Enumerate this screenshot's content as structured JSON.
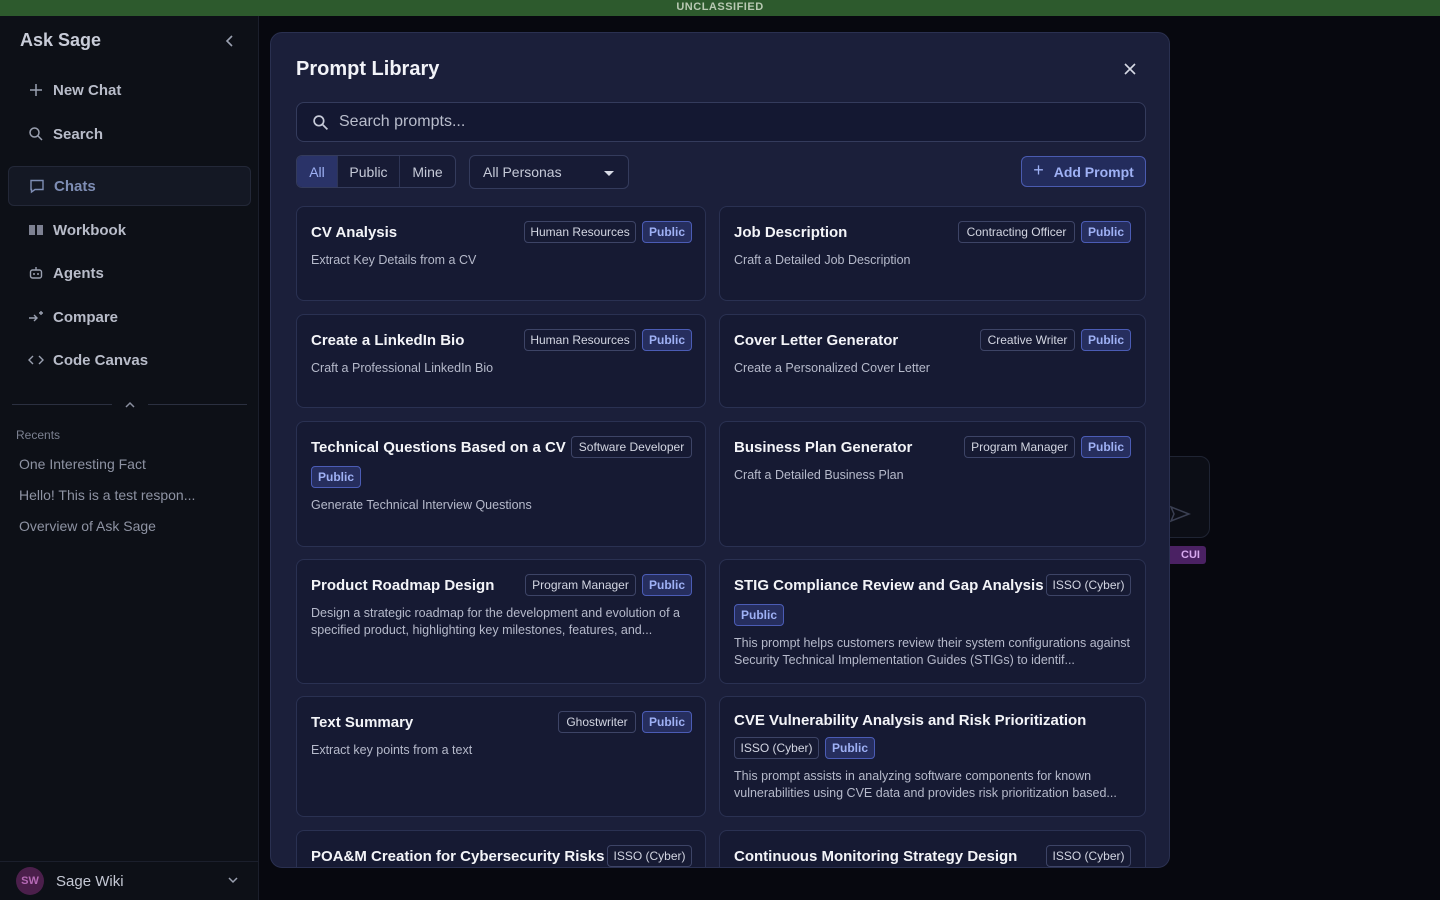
{
  "classification": "UNCLASSIFIED",
  "sidebar": {
    "title": "Ask Sage",
    "actions": [
      {
        "label": "New Chat"
      },
      {
        "label": "Search"
      }
    ],
    "nav": [
      {
        "label": "Chats"
      },
      {
        "label": "Workbook"
      },
      {
        "label": "Agents"
      },
      {
        "label": "Compare"
      },
      {
        "label": "Code Canvas"
      }
    ],
    "recents_label": "Recents",
    "recents": [
      "One Interesting Fact",
      "Hello! This is a test respon...",
      "Overview of Ask Sage"
    ],
    "user": {
      "initials": "SW",
      "name": "Sage Wiki"
    }
  },
  "background": {
    "cui_badge": "CUI"
  },
  "modal": {
    "title": "Prompt Library",
    "search_placeholder": "Search prompts...",
    "filters": [
      "All",
      "Public",
      "Mine"
    ],
    "persona_select": "All Personas",
    "add_button": "Add Prompt",
    "cards": [
      {
        "title": "CV Analysis",
        "persona": "Human Resources",
        "visibility": "Public",
        "desc": "Extract Key Details from a CV"
      },
      {
        "title": "Job Description",
        "persona": "Contracting Officer",
        "visibility": "Public",
        "desc": "Craft a Detailed Job Description"
      },
      {
        "title": "Create a LinkedIn Bio",
        "persona": "Human Resources",
        "visibility": "Public",
        "desc": "Craft a Professional LinkedIn Bio"
      },
      {
        "title": "Cover Letter Generator",
        "persona": "Creative Writer",
        "visibility": "Public",
        "desc": "Create a Personalized Cover Letter"
      },
      {
        "title": "Technical Questions Based on a CV",
        "persona": "Software Developer",
        "visibility": "Public",
        "desc": "Generate Technical Interview Questions"
      },
      {
        "title": "Business Plan Generator",
        "persona": "Program Manager",
        "visibility": "Public",
        "desc": "Craft a Detailed Business Plan"
      },
      {
        "title": "Product Roadmap Design",
        "persona": "Program Manager",
        "visibility": "Public",
        "desc": "Design a strategic roadmap for the development and evolution of a specified product, highlighting key milestones, features, and..."
      },
      {
        "title": "STIG Compliance Review and Gap Analysis",
        "persona": "ISSO (Cyber)",
        "visibility": "Public",
        "desc": "This prompt helps customers review their system configurations against Security Technical Implementation Guides (STIGs) to identif..."
      },
      {
        "title": "Text Summary",
        "persona": "Ghostwriter",
        "visibility": "Public",
        "desc": "Extract key points from a text"
      },
      {
        "title": "CVE Vulnerability Analysis and Risk Prioritization",
        "persona": "ISSO (Cyber)",
        "visibility": "Public",
        "desc": "This prompt assists in analyzing software components for known vulnerabilities using CVE data and provides risk prioritization based..."
      },
      {
        "title": "POA&M Creation for Cybersecurity Risks",
        "persona": "ISSO (Cyber)"
      },
      {
        "title": "Continuous Monitoring Strategy Design",
        "persona": "ISSO (Cyber)"
      }
    ]
  }
}
